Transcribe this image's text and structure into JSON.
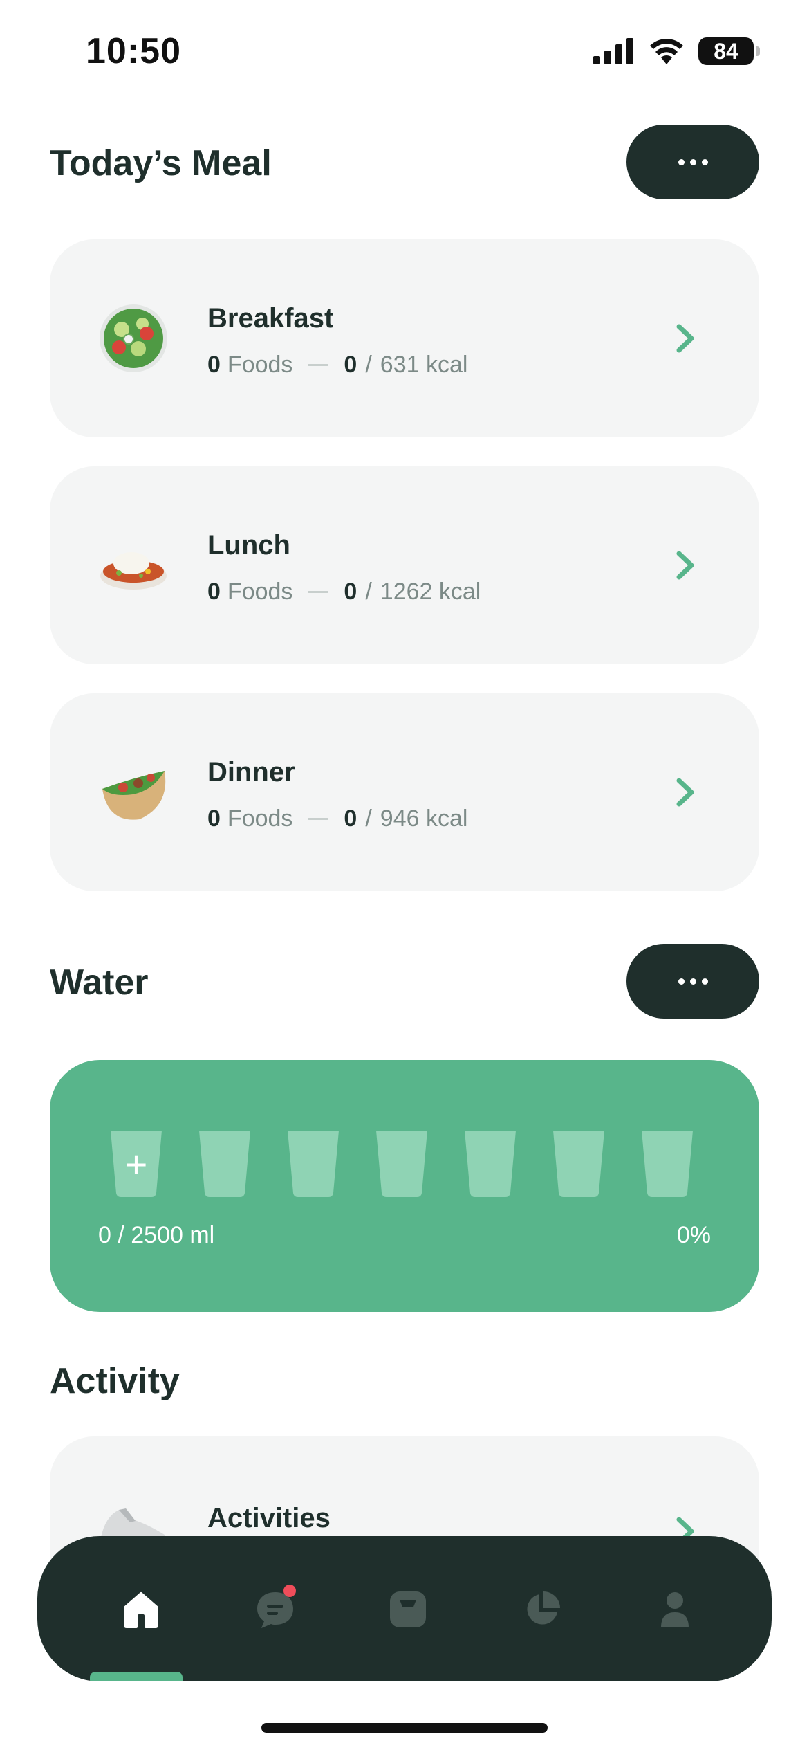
{
  "status_bar": {
    "time": "10:50",
    "battery": "84"
  },
  "meals_section": {
    "title": "Today’s Meal",
    "items": [
      {
        "name": "Breakfast",
        "foods_count": "0",
        "foods_label": "Foods",
        "kcal_consumed": "0",
        "kcal_target": "631 kcal",
        "icon": "salad-icon"
      },
      {
        "name": "Lunch",
        "foods_count": "0",
        "foods_label": "Foods",
        "kcal_consumed": "0",
        "kcal_target": "1262 kcal",
        "icon": "rice-bowl-icon"
      },
      {
        "name": "Dinner",
        "foods_count": "0",
        "foods_label": "Foods",
        "kcal_consumed": "0",
        "kcal_target": "946 kcal",
        "icon": "pita-sandwich-icon"
      }
    ]
  },
  "water_section": {
    "title": "Water",
    "cups_total": 7,
    "cups_filled": 0,
    "amount": "0 / 2500 ml",
    "percent": "0%"
  },
  "activity_section": {
    "title": "Activity",
    "items": [
      {
        "name": "Activities",
        "icon": "sneaker-icon"
      }
    ]
  },
  "bottom_nav": {
    "items": [
      "home-icon",
      "chat-icon",
      "scale-icon",
      "pie-chart-icon",
      "profile-icon"
    ],
    "active": "home-icon"
  },
  "colors": {
    "dark": "#1f2f2c",
    "accent_green": "#58b58b",
    "card_bg": "#f4f5f5",
    "notification": "#ef4d5a"
  }
}
